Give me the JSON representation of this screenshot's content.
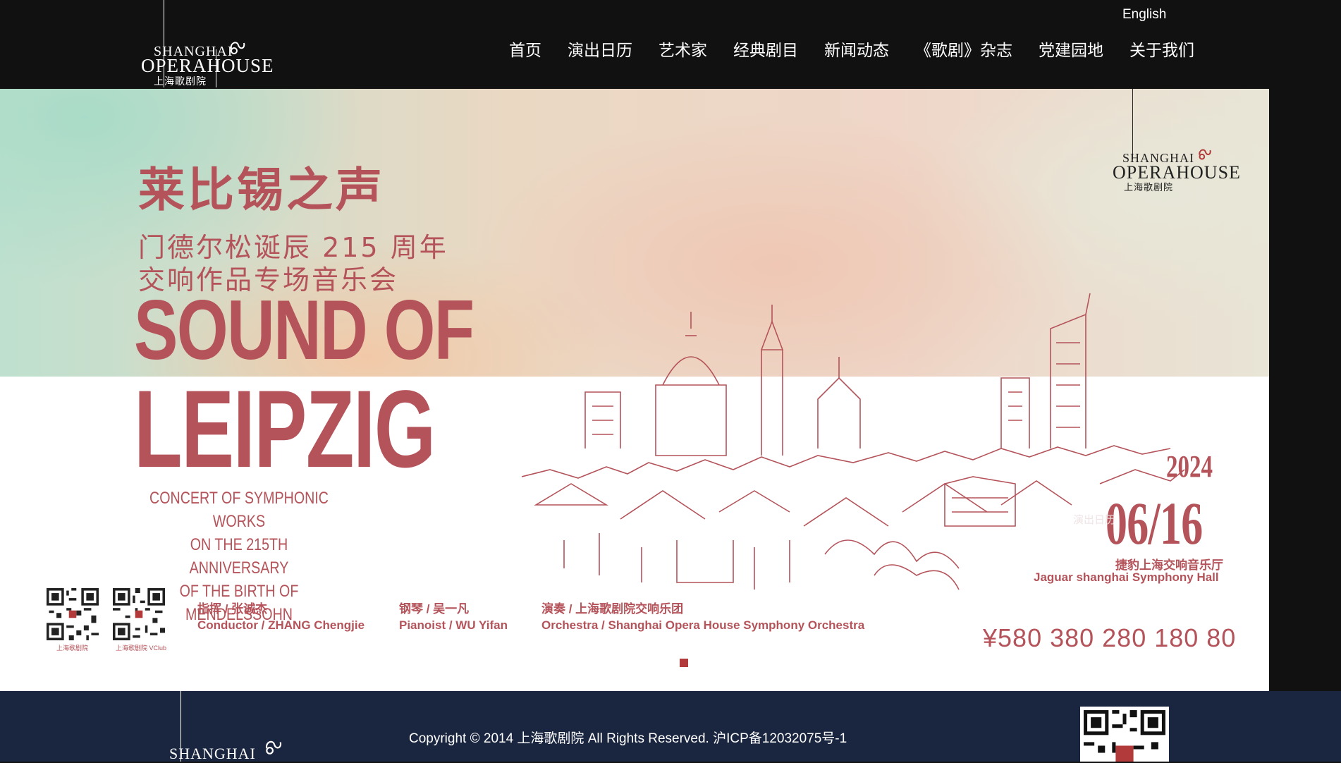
{
  "header": {
    "logo": {
      "line1": "SHANGHAI",
      "line2": "OPERAHOUSE",
      "line3": "上海歌剧院"
    },
    "lang_switch": "English",
    "nav": [
      {
        "label": "首页"
      },
      {
        "label": "演出日历"
      },
      {
        "label": "艺术家"
      },
      {
        "label": "经典剧目"
      },
      {
        "label": "新闻动态"
      },
      {
        "label": "《歌剧》杂志"
      },
      {
        "label": "党建园地"
      },
      {
        "label": "关于我们"
      }
    ]
  },
  "banner": {
    "cn_title": "莱比锡之声",
    "cn_subtitle_1": "门德尔松诞辰 215 周年",
    "cn_subtitle_2": "交响作品专场音乐会",
    "en_title_1": "SOUND OF",
    "en_title_2": "LEIPZIG",
    "en_desc": [
      "CONCERT OF SYMPHONIC WORKS",
      "ON THE 215TH ANNIVERSARY",
      "OF THE BIRTH OF MENDELSSOHN"
    ],
    "right_logo": {
      "line1": "SHANGHAI",
      "line2": "OPERAHOUSE",
      "line3": "上海歌剧院"
    },
    "year": "2024",
    "date": "06/16",
    "ghost_text": "演出日历",
    "venue_cn": "捷豹上海交响音乐厅",
    "venue_en": "Jaguar shanghai Symphony Hall",
    "qr_captions": [
      "上海歌剧院",
      "上海歌剧院 VClub"
    ],
    "credits": [
      {
        "cn": "指挥 / 张诚杰",
        "en": "Conductor / ZHANG Chengjie"
      },
      {
        "cn": "钢琴 / 吴一凡",
        "en": "Pianoist / WU Yifan"
      },
      {
        "cn": "演奏 / 上海歌剧院交响乐团",
        "en": "Orchestra / Shanghai Opera House Symphony Orchestra"
      }
    ],
    "prices": "¥580 380 280 180 80",
    "accent_color": "#b4535a"
  },
  "footer": {
    "logo_text": "SHANGHAI",
    "copyright": "Copyright © 2014 上海歌剧院 All Rights Reserved.    沪ICP备12032075号-1"
  }
}
